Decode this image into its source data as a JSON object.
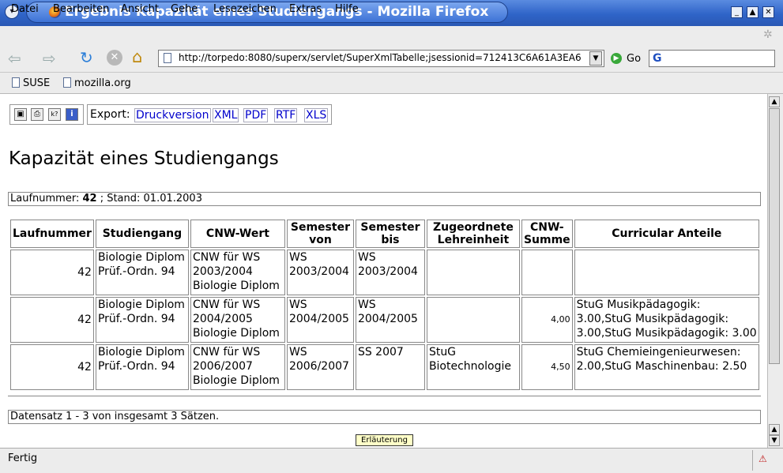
{
  "window": {
    "title": "Ergebnis Kapazität eines Studiengangs - Mozilla Firefox"
  },
  "menu": [
    "Datei",
    "Bearbeiten",
    "Ansicht",
    "Gehe",
    "Lesezeichen",
    "Extras",
    "Hilfe"
  ],
  "nav": {
    "url": "http://torpedo:8080/superx/servlet/SuperXmlTabelle;jsessionid=712413C6A61A3EA6",
    "go_label": "Go",
    "search_placeholder": ""
  },
  "bookmarks": [
    "SUSE",
    "mozilla.org"
  ],
  "report": {
    "export_label": "Export:",
    "export_links": [
      "Druckversion",
      "XML",
      "PDF",
      "RTF",
      "XLS"
    ],
    "title": "Kapazität eines Studiengangs",
    "meta_prefix": "Laufnummer: ",
    "meta_number": "42",
    "meta_suffix": " ; Stand: 01.01.2003",
    "headers": [
      "Laufnummer",
      "Studiengang",
      "CNW-Wert",
      "Semester von",
      "Semester bis",
      "Zugeordnete Lehreinheit",
      "CNW-Summe",
      "Curricular Anteile"
    ],
    "rows": [
      [
        "42",
        "Biologie Diplom Prüf.-Ordn. 94",
        "CNW für WS 2003/2004 Biologie Diplom",
        "WS 2003/2004",
        "WS 2003/2004",
        "",
        "",
        ""
      ],
      [
        "42",
        "Biologie Diplom Prüf.-Ordn. 94",
        "CNW für WS 2004/2005 Biologie Diplom",
        "WS 2004/2005",
        "WS 2004/2005",
        "",
        "4,00",
        "StuG Musikpädagogik: 3.00,StuG Musikpädagogik: 3.00,StuG Musikpädagogik: 3.00"
      ],
      [
        "42",
        "Biologie Diplom Prüf.-Ordn. 94",
        "CNW für WS 2006/2007 Biologie Diplom",
        "WS 2006/2007",
        "SS 2007",
        "StuG Biotechnologie",
        "4,50",
        "StuG Chemieingenieurwesen: 2.00,StuG Maschinenbau: 2.50"
      ]
    ],
    "footer": "Datensatz 1 - 3 von insgesamt 3 Sätzen.",
    "explain_button": "Erläuterung"
  },
  "status": {
    "text": "Fertig"
  },
  "colors": {
    "titlebar": "#2f64c8",
    "link": "#0000cc"
  }
}
